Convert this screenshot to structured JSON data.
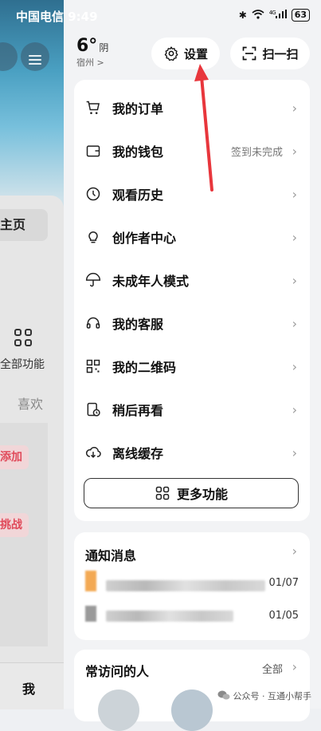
{
  "status": {
    "carrier": "中国电信",
    "time": "9:49",
    "network": "4G",
    "battery": "63"
  },
  "left_app": {
    "home_tab": "主页",
    "all_functions": "全部功能",
    "like_tab": "喜欢",
    "pill_1": "添加",
    "pill_2": "挑战",
    "me_tab": "我"
  },
  "weather": {
    "temperature": "6°",
    "condition": "阴",
    "city": "宿州 >"
  },
  "header": {
    "settings_label": "设置",
    "scan_label": "扫一扫"
  },
  "menu": {
    "items": [
      {
        "label": "我的订单",
        "icon": "cart-icon"
      },
      {
        "label": "我的钱包",
        "icon": "wallet-icon",
        "note": "签到未完成"
      },
      {
        "label": "观看历史",
        "icon": "clock-icon"
      },
      {
        "label": "创作者中心",
        "icon": "lightbulb-icon"
      },
      {
        "label": "未成年人模式",
        "icon": "umbrella-icon"
      },
      {
        "label": "我的客服",
        "icon": "headset-icon"
      },
      {
        "label": "我的二维码",
        "icon": "qrcode-icon"
      },
      {
        "label": "稍后再看",
        "icon": "watch-later-icon"
      },
      {
        "label": "离线缓存",
        "icon": "cloud-download-icon"
      }
    ],
    "more_label": "更多功能"
  },
  "notifications": {
    "title": "通知消息",
    "rows": [
      {
        "date": "01/07"
      },
      {
        "date": "01/05"
      }
    ]
  },
  "frequent": {
    "title": "常访问的人",
    "all_label": "全部"
  },
  "watermark": {
    "text": "公众号 · 互通小帮手"
  },
  "colors": {
    "accent_red": "#e8363c",
    "card_bg": "#ffffff",
    "panel_bg": "#f2f3f5"
  }
}
